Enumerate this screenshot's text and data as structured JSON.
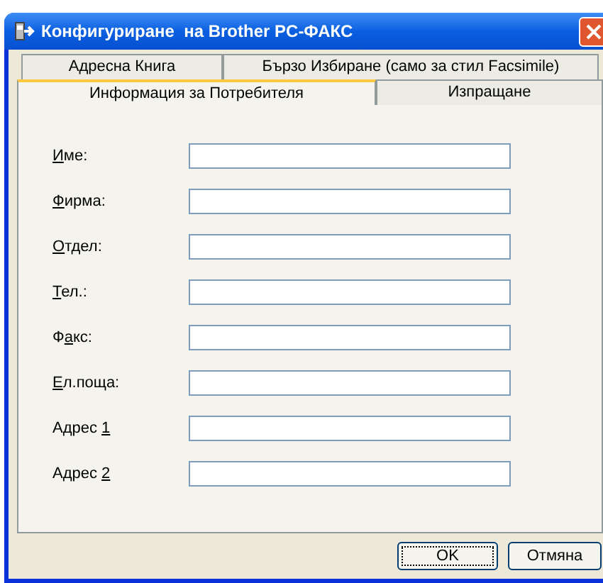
{
  "window": {
    "title": "Конфигуриране  на Brother PC-ФАКС"
  },
  "tab_rows": [
    {
      "tabs": [
        {
          "label": "Адресна Книга",
          "selected": false
        },
        {
          "label": "Бързо Избиране (само за стил Facsimile)",
          "selected": false
        }
      ]
    },
    {
      "tabs": [
        {
          "label": "Информация за Потребителя",
          "selected": true
        },
        {
          "label": "Изпращане",
          "selected": false
        }
      ]
    }
  ],
  "fields": [
    {
      "access_key": "И",
      "label_after": "ме:"
    },
    {
      "access_key": "Ф",
      "label_after": "ирма:"
    },
    {
      "access_key": "О",
      "label_after": "тдел:"
    },
    {
      "access_key": "Т",
      "label_after": "ел.:"
    },
    {
      "label_before": "Ф",
      "access_key": "а",
      "label_after": "кс:"
    },
    {
      "access_key": "Е",
      "label_after": "л.поща:"
    },
    {
      "label_before": "Адрес ",
      "access_key": "1"
    },
    {
      "label_before": "Адрес ",
      "access_key": "2"
    }
  ],
  "buttons": [
    {
      "label": "OK",
      "default": true
    },
    {
      "label": "Отмяна",
      "default": false
    }
  ]
}
